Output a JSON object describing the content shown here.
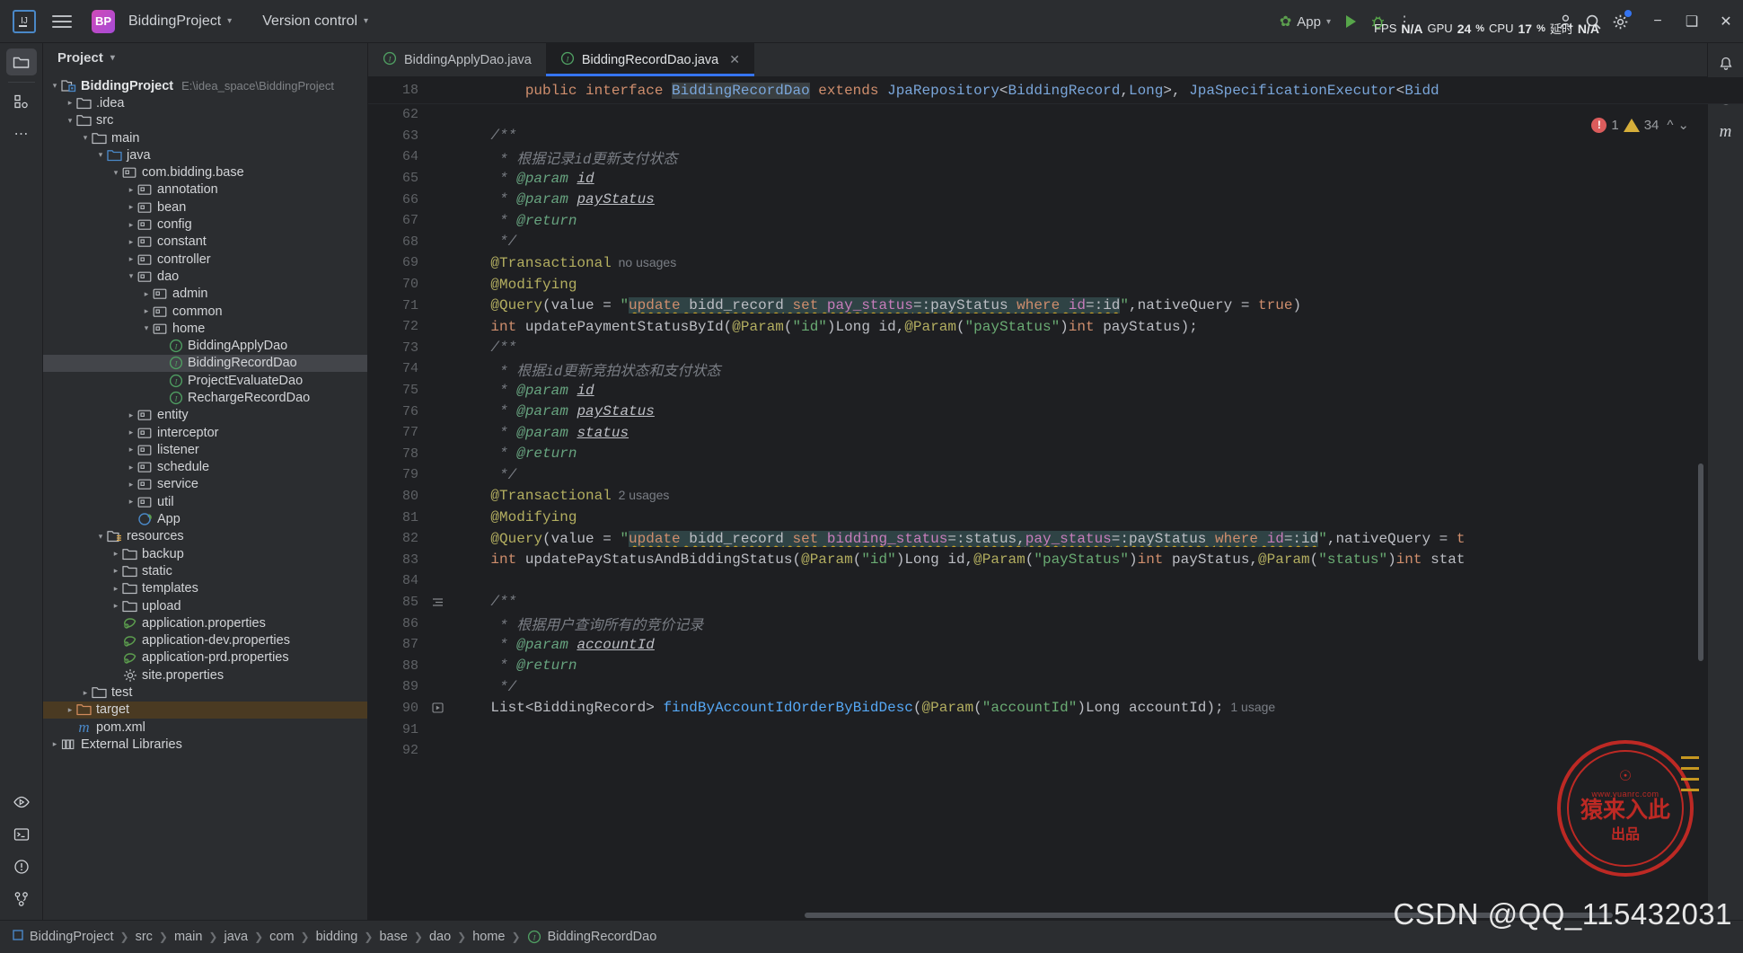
{
  "titlebar": {
    "logo_text": "IJ",
    "project_badge": "BP",
    "project_name": "BiddingProject",
    "version_control": "Version control",
    "run_config": "App",
    "icons": {
      "menu": "hamburger-menu-icon",
      "run": "run-icon",
      "debug": "debug-icon",
      "more": "more-options-icon",
      "account": "account-icon",
      "search": "search-icon",
      "settings": "settings-icon",
      "minimize": "minimize-icon",
      "maximize": "maximize-icon",
      "close": "close-icon"
    },
    "perf": {
      "fps_label": "FPS",
      "fps_value": "N/A",
      "gpu_label": "GPU",
      "gpu_value": "24",
      "gpu_pct": "%",
      "cpu_label": "CPU",
      "cpu_value": "17",
      "cpu_pct": "%",
      "latency_label": "延时",
      "latency_value": "N/A"
    }
  },
  "left_rail": {
    "items": [
      {
        "name": "project-tool-icon",
        "active": true
      },
      {
        "name": "structure-tool-icon",
        "active": false
      },
      {
        "name": "more-tool-windows-icon",
        "active": false
      }
    ],
    "bottom_items": [
      {
        "name": "run-tool-icon"
      },
      {
        "name": "terminal-tool-icon"
      },
      {
        "name": "problems-tool-icon"
      },
      {
        "name": "version-control-tool-icon"
      }
    ]
  },
  "project_panel": {
    "title": "Project",
    "tree": [
      {
        "depth": 0,
        "arrow": "down",
        "icon": "module-icon",
        "label": "BiddingProject",
        "bold": true,
        "hint": "E:\\idea_space\\BiddingProject"
      },
      {
        "depth": 1,
        "arrow": "right",
        "icon": "folder-icon",
        "label": ".idea"
      },
      {
        "depth": 1,
        "arrow": "down",
        "icon": "folder-icon",
        "label": "src"
      },
      {
        "depth": 2,
        "arrow": "down",
        "icon": "folder-icon",
        "label": "main"
      },
      {
        "depth": 3,
        "arrow": "down",
        "icon": "source-folder-icon",
        "label": "java"
      },
      {
        "depth": 4,
        "arrow": "down",
        "icon": "package-icon",
        "label": "com.bidding.base"
      },
      {
        "depth": 5,
        "arrow": "right",
        "icon": "package-icon",
        "label": "annotation"
      },
      {
        "depth": 5,
        "arrow": "right",
        "icon": "package-icon",
        "label": "bean"
      },
      {
        "depth": 5,
        "arrow": "right",
        "icon": "package-icon",
        "label": "config"
      },
      {
        "depth": 5,
        "arrow": "right",
        "icon": "package-icon",
        "label": "constant"
      },
      {
        "depth": 5,
        "arrow": "right",
        "icon": "package-icon",
        "label": "controller"
      },
      {
        "depth": 5,
        "arrow": "down",
        "icon": "package-icon",
        "label": "dao"
      },
      {
        "depth": 6,
        "arrow": "right",
        "icon": "package-icon",
        "label": "admin"
      },
      {
        "depth": 6,
        "arrow": "right",
        "icon": "package-icon",
        "label": "common"
      },
      {
        "depth": 6,
        "arrow": "down",
        "icon": "package-icon",
        "label": "home"
      },
      {
        "depth": 7,
        "arrow": "none",
        "icon": "interface-icon",
        "label": "BiddingApplyDao"
      },
      {
        "depth": 7,
        "arrow": "none",
        "icon": "interface-icon",
        "label": "BiddingRecordDao",
        "selected": true
      },
      {
        "depth": 7,
        "arrow": "none",
        "icon": "interface-icon",
        "label": "ProjectEvaluateDao"
      },
      {
        "depth": 7,
        "arrow": "none",
        "icon": "interface-icon",
        "label": "RechargeRecordDao"
      },
      {
        "depth": 5,
        "arrow": "right",
        "icon": "package-icon",
        "label": "entity"
      },
      {
        "depth": 5,
        "arrow": "right",
        "icon": "package-icon",
        "label": "interceptor"
      },
      {
        "depth": 5,
        "arrow": "right",
        "icon": "package-icon",
        "label": "listener"
      },
      {
        "depth": 5,
        "arrow": "right",
        "icon": "package-icon",
        "label": "schedule"
      },
      {
        "depth": 5,
        "arrow": "right",
        "icon": "package-icon",
        "label": "service"
      },
      {
        "depth": 5,
        "arrow": "right",
        "icon": "package-icon",
        "label": "util"
      },
      {
        "depth": 5,
        "arrow": "none",
        "icon": "spring-class-icon",
        "label": "App"
      },
      {
        "depth": 3,
        "arrow": "down",
        "icon": "resources-folder-icon",
        "label": "resources"
      },
      {
        "depth": 4,
        "arrow": "right",
        "icon": "folder-icon",
        "label": "backup"
      },
      {
        "depth": 4,
        "arrow": "right",
        "icon": "folder-icon",
        "label": "static"
      },
      {
        "depth": 4,
        "arrow": "right",
        "icon": "folder-icon",
        "label": "templates"
      },
      {
        "depth": 4,
        "arrow": "right",
        "icon": "folder-icon",
        "label": "upload"
      },
      {
        "depth": 4,
        "arrow": "none",
        "icon": "spring-properties-icon",
        "label": "application.properties"
      },
      {
        "depth": 4,
        "arrow": "none",
        "icon": "spring-properties-icon",
        "label": "application-dev.properties"
      },
      {
        "depth": 4,
        "arrow": "none",
        "icon": "spring-properties-icon",
        "label": "application-prd.properties"
      },
      {
        "depth": 4,
        "arrow": "none",
        "icon": "properties-icon",
        "label": "site.properties"
      },
      {
        "depth": 2,
        "arrow": "right",
        "icon": "folder-icon",
        "label": "test"
      },
      {
        "depth": 1,
        "arrow": "right",
        "icon": "target-folder-icon",
        "label": "target",
        "target": true
      },
      {
        "depth": 1,
        "arrow": "none",
        "icon": "maven-icon",
        "label": "pom.xml"
      },
      {
        "depth": 0,
        "arrow": "right",
        "icon": "libraries-icon",
        "label": "External Libraries"
      }
    ]
  },
  "editor": {
    "tabs": [
      {
        "icon": "interface-icon",
        "label": "BiddingApplyDao.java",
        "active": false,
        "closable": false
      },
      {
        "icon": "interface-icon",
        "label": "BiddingRecordDao.java",
        "active": true,
        "closable": true
      }
    ],
    "inspections": {
      "errors": "1",
      "warnings": "34"
    },
    "sticky_line_number": "18",
    "sticky_line": "public interface BiddingRecordDao extends JpaRepository<BiddingRecord,Long>, JpaSpecificationExecutor<Bidd",
    "lines": [
      {
        "n": "62",
        "segs": []
      },
      {
        "n": "63",
        "segs": [
          {
            "t": "    /**",
            "c": "cmt"
          }
        ]
      },
      {
        "n": "64",
        "segs": [
          {
            "t": "     * ",
            "c": "cmt"
          },
          {
            "t": "根据记录id更新支付状态",
            "c": "cmt"
          }
        ]
      },
      {
        "n": "65",
        "segs": [
          {
            "t": "     * ",
            "c": "cmt"
          },
          {
            "t": "@param",
            "c": "doctag"
          },
          {
            "t": " ",
            "c": "cmt"
          },
          {
            "t": "id",
            "c": "docparam"
          }
        ]
      },
      {
        "n": "66",
        "segs": [
          {
            "t": "     * ",
            "c": "cmt"
          },
          {
            "t": "@param",
            "c": "doctag"
          },
          {
            "t": " ",
            "c": "cmt"
          },
          {
            "t": "payStatus",
            "c": "docparam"
          }
        ]
      },
      {
        "n": "67",
        "segs": [
          {
            "t": "     * ",
            "c": "cmt"
          },
          {
            "t": "@return",
            "c": "doctag"
          }
        ]
      },
      {
        "n": "68",
        "segs": [
          {
            "t": "     */",
            "c": "cmt"
          }
        ]
      },
      {
        "n": "69",
        "segs": [
          {
            "t": "    @Transactional",
            "c": "ann"
          },
          {
            "t": "  no usages",
            "c": "usage"
          }
        ]
      },
      {
        "n": "70",
        "segs": [
          {
            "t": "    @Modifying",
            "c": "ann"
          }
        ]
      },
      {
        "n": "71",
        "sql": 1
      },
      {
        "n": "72",
        "segs": [
          {
            "t": "    int",
            "c": "kw"
          },
          {
            "t": " ",
            "c": "plain"
          },
          {
            "t": "updatePaymentStatusById",
            "c": "plain"
          },
          {
            "t": "(",
            "c": "plain"
          },
          {
            "t": "@Param",
            "c": "ann"
          },
          {
            "t": "(",
            "c": "plain"
          },
          {
            "t": "\"id\"",
            "c": "str"
          },
          {
            "t": ")",
            "c": "plain"
          },
          {
            "t": "Long",
            "c": "plain"
          },
          {
            "t": " id,",
            "c": "plain"
          },
          {
            "t": "@Param",
            "c": "ann"
          },
          {
            "t": "(",
            "c": "plain"
          },
          {
            "t": "\"payStatus\"",
            "c": "str"
          },
          {
            "t": ")",
            "c": "plain"
          },
          {
            "t": "int",
            "c": "kw"
          },
          {
            "t": " payStatus);",
            "c": "plain"
          }
        ]
      },
      {
        "n": "73",
        "segs": [
          {
            "t": "    /**",
            "c": "cmt"
          }
        ]
      },
      {
        "n": "74",
        "segs": [
          {
            "t": "     * ",
            "c": "cmt"
          },
          {
            "t": "根据id更新竞拍状态和支付状态",
            "c": "cmt"
          }
        ]
      },
      {
        "n": "75",
        "segs": [
          {
            "t": "     * ",
            "c": "cmt"
          },
          {
            "t": "@param",
            "c": "doctag"
          },
          {
            "t": " ",
            "c": "cmt"
          },
          {
            "t": "id",
            "c": "docparam"
          }
        ]
      },
      {
        "n": "76",
        "segs": [
          {
            "t": "     * ",
            "c": "cmt"
          },
          {
            "t": "@param",
            "c": "doctag"
          },
          {
            "t": " ",
            "c": "cmt"
          },
          {
            "t": "payStatus",
            "c": "docparam"
          }
        ]
      },
      {
        "n": "77",
        "segs": [
          {
            "t": "     * ",
            "c": "cmt"
          },
          {
            "t": "@param",
            "c": "doctag"
          },
          {
            "t": " ",
            "c": "cmt"
          },
          {
            "t": "status",
            "c": "docparam"
          }
        ]
      },
      {
        "n": "78",
        "segs": [
          {
            "t": "     * ",
            "c": "cmt"
          },
          {
            "t": "@return",
            "c": "doctag"
          }
        ]
      },
      {
        "n": "79",
        "segs": [
          {
            "t": "     */",
            "c": "cmt"
          }
        ]
      },
      {
        "n": "80",
        "segs": [
          {
            "t": "    @Transactional",
            "c": "ann"
          },
          {
            "t": "  2 usages",
            "c": "usage"
          }
        ]
      },
      {
        "n": "81",
        "segs": [
          {
            "t": "    @Modifying",
            "c": "ann"
          }
        ]
      },
      {
        "n": "82",
        "sql": 2
      },
      {
        "n": "83",
        "segs": [
          {
            "t": "    int",
            "c": "kw"
          },
          {
            "t": " ",
            "c": "plain"
          },
          {
            "t": "updatePayStatusAndBiddingStatus",
            "c": "plain"
          },
          {
            "t": "(",
            "c": "plain"
          },
          {
            "t": "@Param",
            "c": "ann"
          },
          {
            "t": "(",
            "c": "plain"
          },
          {
            "t": "\"id\"",
            "c": "str"
          },
          {
            "t": ")",
            "c": "plain"
          },
          {
            "t": "Long",
            "c": "plain"
          },
          {
            "t": " id,",
            "c": "plain"
          },
          {
            "t": "@Param",
            "c": "ann"
          },
          {
            "t": "(",
            "c": "plain"
          },
          {
            "t": "\"payStatus\"",
            "c": "str"
          },
          {
            "t": ")",
            "c": "plain"
          },
          {
            "t": "int",
            "c": "kw"
          },
          {
            "t": " payStatus,",
            "c": "plain"
          },
          {
            "t": "@Param",
            "c": "ann"
          },
          {
            "t": "(",
            "c": "plain"
          },
          {
            "t": "\"status\"",
            "c": "str"
          },
          {
            "t": ")",
            "c": "plain"
          },
          {
            "t": "int",
            "c": "kw"
          },
          {
            "t": " stat",
            "c": "plain"
          }
        ]
      },
      {
        "n": "84",
        "segs": []
      },
      {
        "n": "85",
        "segs": [
          {
            "t": "    /**",
            "c": "cmt"
          }
        ],
        "fold": true
      },
      {
        "n": "86",
        "segs": [
          {
            "t": "     * ",
            "c": "cmt"
          },
          {
            "t": "根据用户查询所有的竞价记录",
            "c": "cmt"
          }
        ]
      },
      {
        "n": "87",
        "segs": [
          {
            "t": "     * ",
            "c": "cmt"
          },
          {
            "t": "@param",
            "c": "doctag"
          },
          {
            "t": " ",
            "c": "cmt"
          },
          {
            "t": "accountId",
            "c": "docparam"
          }
        ]
      },
      {
        "n": "88",
        "segs": [
          {
            "t": "     * ",
            "c": "cmt"
          },
          {
            "t": "@return",
            "c": "doctag"
          }
        ]
      },
      {
        "n": "89",
        "segs": [
          {
            "t": "     */",
            "c": "cmt"
          }
        ]
      },
      {
        "n": "90",
        "segs": [
          {
            "t": "    List<BiddingRecord>",
            "c": "plain"
          },
          {
            "t": " ",
            "c": "plain"
          },
          {
            "t": "findByAccountIdOrderByBidDesc",
            "c": "mth"
          },
          {
            "t": "(",
            "c": "plain"
          },
          {
            "t": "@Param",
            "c": "ann"
          },
          {
            "t": "(",
            "c": "plain"
          },
          {
            "t": "\"accountId\"",
            "c": "str"
          },
          {
            "t": ")",
            "c": "plain"
          },
          {
            "t": "Long",
            "c": "plain"
          },
          {
            "t": " accountId);",
            "c": "plain"
          },
          {
            "t": "  1 usage",
            "c": "usage"
          }
        ],
        "bookmark": true
      },
      {
        "n": "91",
        "segs": []
      },
      {
        "n": "92",
        "segs": []
      }
    ],
    "sql_71": {
      "prefix": "    @Query(value = \"",
      "parts": [
        {
          "t": "update",
          "c": "sql-kw"
        },
        {
          "t": " ",
          "c": "sql-tbl"
        },
        {
          "t": "bidd_record",
          "c": "sql-tbl"
        },
        {
          "t": " ",
          "c": "sql-tbl"
        },
        {
          "t": "set",
          "c": "sql-kw"
        },
        {
          "t": " ",
          "c": "sql-tbl"
        },
        {
          "t": "pay_status",
          "c": "sql-col"
        },
        {
          "t": "=:payStatus ",
          "c": "sql-par"
        },
        {
          "t": "where",
          "c": "sql-kw"
        },
        {
          "t": " ",
          "c": "sql-tbl"
        },
        {
          "t": "id",
          "c": "sql-col"
        },
        {
          "t": "=:id",
          "c": "sql-par"
        }
      ],
      "suffix": "\",nativeQuery = ",
      "tail_kw": "true",
      "tail_end": ")"
    },
    "sql_82": {
      "prefix": "    @Query(value = \"",
      "parts": [
        {
          "t": "update",
          "c": "sql-kw"
        },
        {
          "t": " ",
          "c": "sql-tbl"
        },
        {
          "t": "bidd_record",
          "c": "sql-tbl"
        },
        {
          "t": " ",
          "c": "sql-tbl"
        },
        {
          "t": "set",
          "c": "sql-kw"
        },
        {
          "t": " ",
          "c": "sql-tbl"
        },
        {
          "t": "bidding_status",
          "c": "sql-col"
        },
        {
          "t": "=:status,",
          "c": "sql-par"
        },
        {
          "t": "pay_status",
          "c": "sql-col"
        },
        {
          "t": "=:payStatus ",
          "c": "sql-par"
        },
        {
          "t": "where",
          "c": "sql-kw"
        },
        {
          "t": " ",
          "c": "sql-tbl"
        },
        {
          "t": "id",
          "c": "sql-col"
        },
        {
          "t": "=:id",
          "c": "sql-par"
        }
      ],
      "suffix": "\",nativeQuery = ",
      "tail_kw": "t",
      "tail_end": ""
    }
  },
  "right_rail": {
    "items": [
      {
        "name": "notifications-icon"
      },
      {
        "name": "database-icon"
      },
      {
        "name": "maven-icon"
      }
    ]
  },
  "statusbar": {
    "breadcrumb": [
      "BiddingProject",
      "src",
      "main",
      "java",
      "com",
      "bidding",
      "base",
      "dao",
      "home",
      "BiddingRecordDao"
    ]
  },
  "watermark": {
    "stamp_url": "www.yuanrc.com",
    "stamp_main": "猿来入此",
    "stamp_sub": "出品",
    "csdn": "CSDN @QQ_115432031"
  },
  "colors": {
    "accent": "#3574f0",
    "bg": "#1e1f22",
    "panel": "#2b2d30",
    "selection": "#43454a",
    "error": "#db5c5c",
    "warning": "#d6ae3a",
    "sql_bg": "#2f4345"
  }
}
